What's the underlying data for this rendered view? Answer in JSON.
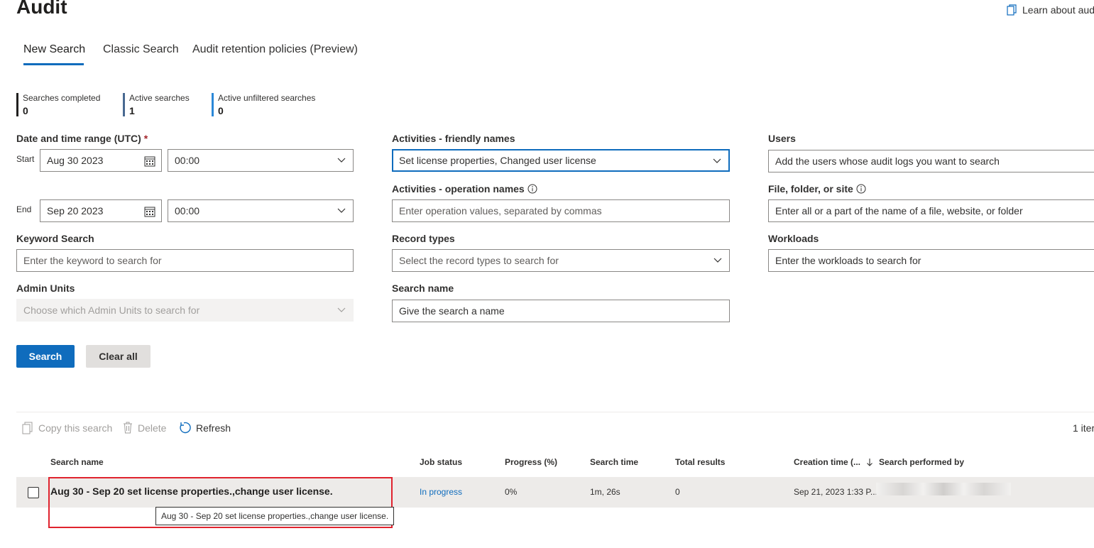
{
  "page": {
    "title": "Audit",
    "learn_link": "Learn about aud"
  },
  "tabs": [
    {
      "label": "New Search",
      "active": true
    },
    {
      "label": "Classic Search",
      "active": false
    },
    {
      "label": "Audit retention policies (Preview)",
      "active": false
    }
  ],
  "stats": [
    {
      "label": "Searches completed",
      "value": "0",
      "color": "#201f1e"
    },
    {
      "label": "Active searches",
      "value": "1",
      "color": "#486991"
    },
    {
      "label": "Active unfiltered searches",
      "value": "0",
      "color": "#2b88d8"
    }
  ],
  "form": {
    "date_range_label": "Date and time range (UTC)",
    "required_mark": "*",
    "start_label": "Start",
    "start_date": "Aug 30 2023",
    "start_time": "00:00",
    "end_label": "End",
    "end_date": "Sep 20 2023",
    "end_time": "00:00",
    "keyword_label": "Keyword Search",
    "keyword_placeholder": "Enter the keyword to search for",
    "admin_units_label": "Admin Units",
    "admin_units_placeholder": "Choose which Admin Units to search for",
    "activities_friendly_label": "Activities - friendly names",
    "activities_friendly_value": "Set license properties, Changed user license",
    "activities_operation_label": "Activities - operation names",
    "activities_operation_placeholder": "Enter operation values, separated by commas",
    "record_types_label": "Record types",
    "record_types_placeholder": "Select the record types to search for",
    "search_name_label": "Search name",
    "search_name_placeholder": "Give the search a name",
    "users_label": "Users",
    "users_placeholder": "Add the users whose audit logs you want to search",
    "file_label": "File, folder, or site",
    "file_placeholder": "Enter all or a part of the name of a file, website, or folder",
    "workloads_label": "Workloads",
    "workloads_placeholder": "Enter the workloads to search for"
  },
  "buttons": {
    "search": "Search",
    "clear_all": "Clear all"
  },
  "toolbar": {
    "copy": "Copy this search",
    "delete": "Delete",
    "refresh": "Refresh",
    "item_count": "1 iter"
  },
  "table": {
    "headers": {
      "name": "Search name",
      "status": "Job status",
      "progress": "Progress (%)",
      "time": "Search time",
      "results": "Total results",
      "created": "Creation time (...",
      "by": "Search performed by"
    },
    "rows": [
      {
        "name": "Aug 30 - Sep 20 set license properties.,change user license.",
        "status": "In progress",
        "progress": "0%",
        "time": "1m, 26s",
        "results": "0",
        "created": "Sep 21, 2023 1:33 P..."
      }
    ]
  },
  "tooltip": "Aug 30 - Sep 20 set license properties.,change user license."
}
